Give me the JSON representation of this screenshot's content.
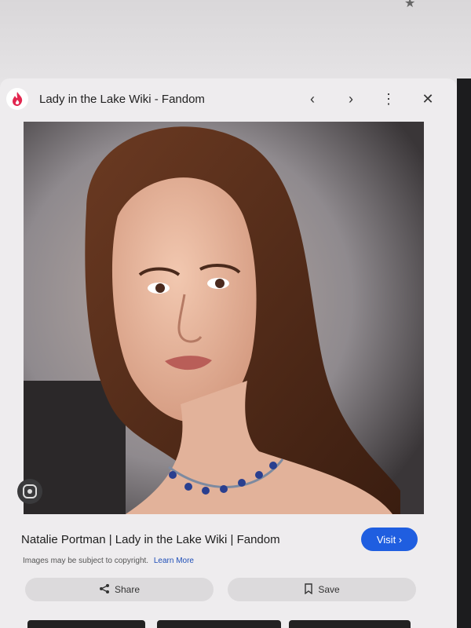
{
  "header": {
    "site_title": "Lady in the Lake Wiki - Fandom",
    "favicon_icon": "fandom-flame-icon",
    "brand_color": "#e2264f"
  },
  "controls": {
    "prev_icon": "‹",
    "next_icon": "›",
    "more_icon": "⋮",
    "close_icon": "✕"
  },
  "image": {
    "alt": "Natalie Portman"
  },
  "caption": {
    "text": "Natalie Portman | Lady in the Lake Wiki | Fandom"
  },
  "visit_button": {
    "label": "Visit ›",
    "color": "#1f5ee0"
  },
  "copyright": {
    "text": "Images may be subject to copyright.",
    "link": "Learn More"
  },
  "actions": {
    "share_label": "Share",
    "save_label": "Save"
  }
}
